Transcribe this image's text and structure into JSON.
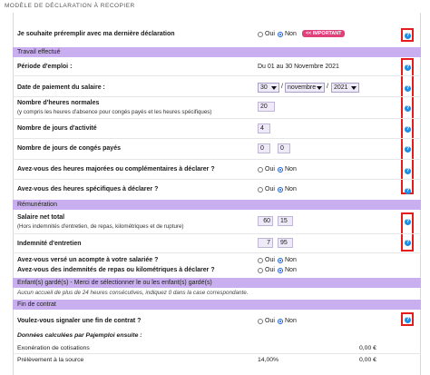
{
  "title": "MODÈLE DE DÉCLARATION À RECOPIER",
  "prefill": {
    "label": "Je souhaite préremplir avec ma dernière déclaration",
    "oui": "Oui",
    "non": "Non",
    "selected": "Non",
    "badge": "<< IMPORTANT"
  },
  "sections": {
    "travail": "Travail effectué",
    "remuneration": "Rémunération",
    "enfants": "Enfant(s) gardé(s) - Merci de sélectionner le ou les enfant(s) gardé(s)",
    "fin": "Fin de contrat"
  },
  "travail": {
    "periode_label": "Période d'emploi :",
    "periode_value": "Du 01 au 30 Novembre 2021",
    "date_label": "Date de paiement du salaire :",
    "date_day": "30",
    "date_month": "novembre",
    "date_year": "2021",
    "date_sep": "/",
    "heures_label": "Nombre d'heures normales",
    "heures_sub": "(y compris les heures d'absence pour congés payés et les heures spécifiques)",
    "heures_value": "20",
    "jours_label": "Nombre de jours d'activité",
    "jours_value": "4",
    "conges_label": "Nombre de jours de congés payés",
    "conges_int": "0",
    "conges_dec": "0",
    "majorees_label": "Avez-vous des heures majorées ou complémentaires à déclarer ?",
    "specifiques_label": "Avez-vous des heures spécifiques à déclarer ?"
  },
  "remuneration": {
    "salaire_label": "Salaire net total",
    "salaire_sub": "(Hors indemnités d'entretien, de repas, kilométriques et de rupture)",
    "salaire_int": "60",
    "salaire_dec": "15",
    "entretien_label": "Indemnité d'entretien",
    "entretien_int": "7",
    "entretien_dec": "95",
    "acompte_label": "Avez-vous versé un acompte à votre salariée ?",
    "repas_label": "Avez-vous des indemnités de repas ou kilométriques à déclarer ?"
  },
  "enfants_hint": "Aucun accueil de plus de 24 heures consécutives, indiquez 0 dans la case correspondante.",
  "fin": {
    "signaler_label": "Voulez-vous signaler une fin de contrat ?",
    "donnees_label": "Données calculées par Pajemploi ensuite :",
    "exoneration_label": "Exonération de cotisations",
    "exoneration_value": "0,00 €",
    "prelevement_label": "Prélèvement à la source",
    "prelevement_rate": "14,00%",
    "prelevement_value": "0,00 €"
  },
  "radio": {
    "oui": "Oui",
    "non": "Non"
  },
  "help_glyph": "?",
  "colors": {
    "section_bg": "#c9aef0",
    "help_border": "#e31c1c",
    "help_icon": "#1e8ee6",
    "badge": "#e0407a"
  }
}
